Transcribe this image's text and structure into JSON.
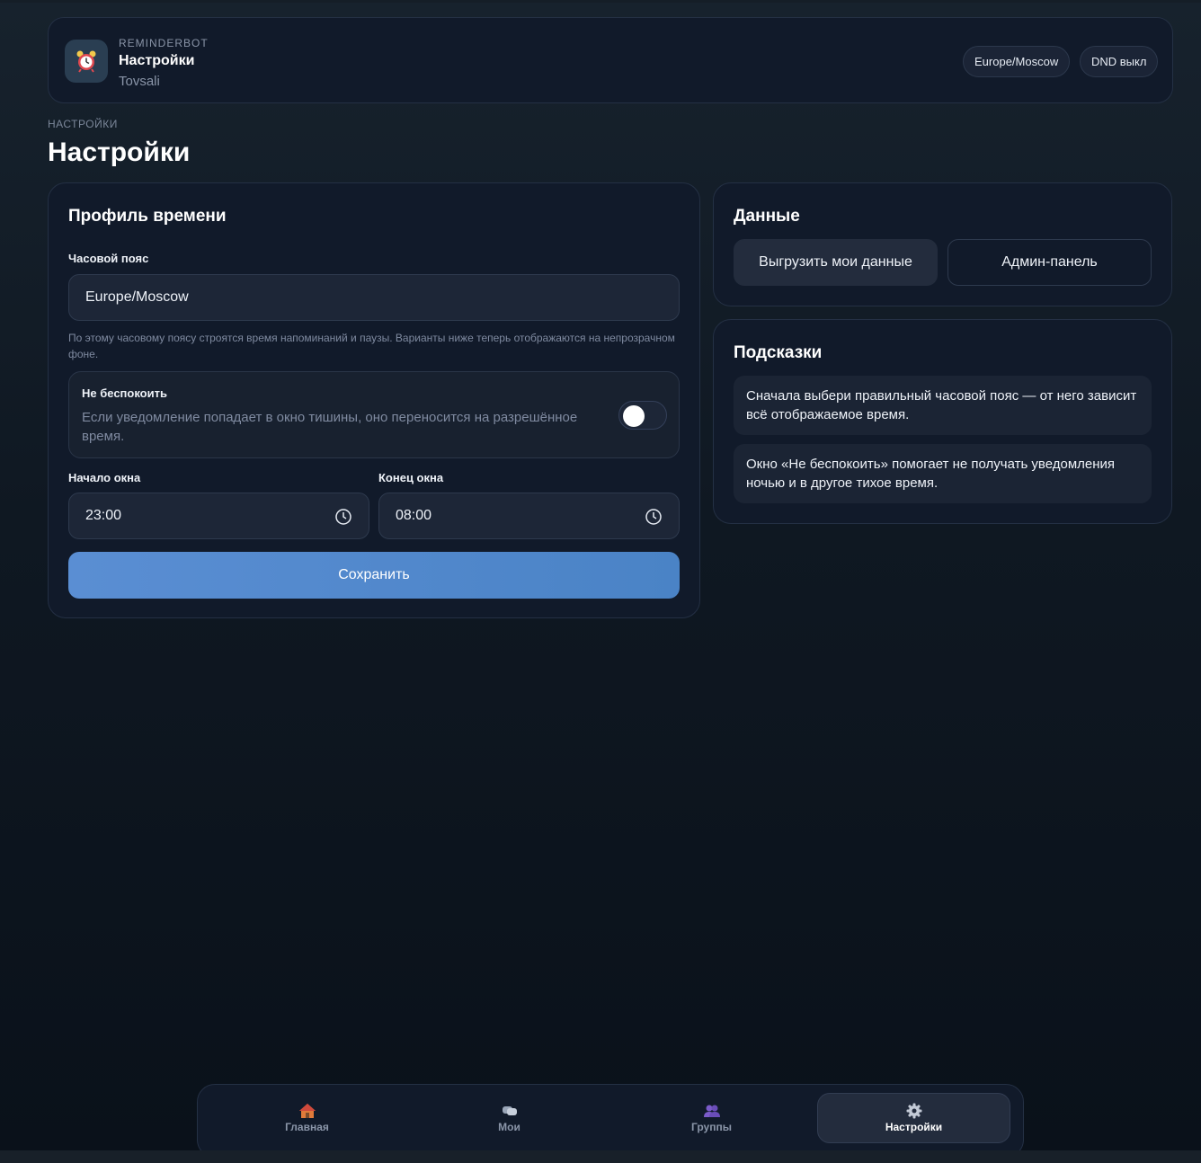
{
  "header": {
    "brand": "REMINDERBOT",
    "title": "Настройки",
    "user": "Tovsali",
    "timezone_pill": "Europe/Moscow",
    "dnd_pill": "DND выкл"
  },
  "page": {
    "section_label": "НАСТРОЙКИ",
    "title": "Настройки"
  },
  "profile": {
    "title": "Профиль времени",
    "timezone_label": "Часовой пояс",
    "timezone_value": "Europe/Moscow",
    "timezone_hint": "По этому часовому поясу строятся время напоминаний и паузы. Варианты ниже теперь отображаются на непрозрачном фоне.",
    "dnd": {
      "title": "Не беспокоить",
      "description": "Если уведомление попадает в окно тишины, оно переносится на разрешённое время.",
      "enabled": false
    },
    "window_start_label": "Начало окна",
    "window_start_value": "23:00",
    "window_end_label": "Конец окна",
    "window_end_value": "08:00",
    "save_label": "Сохранить"
  },
  "data_card": {
    "title": "Данные",
    "export_label": "Выгрузить мои данные",
    "admin_label": "Админ-панель"
  },
  "tips_card": {
    "title": "Подсказки",
    "tips": [
      "Сначала выбери правильный часовой пояс — от него зависит всё отображаемое время.",
      "Окно «Не беспокоить» помогает не получать уведомления ночью и в другое тихое время."
    ]
  },
  "nav": {
    "items": [
      {
        "label": "Главная",
        "icon": "house-icon"
      },
      {
        "label": "Мои",
        "icon": "chat-icon"
      },
      {
        "label": "Группы",
        "icon": "users-icon"
      },
      {
        "label": "Настройки",
        "icon": "gear-icon",
        "active": true
      }
    ]
  },
  "colors": {
    "accent": "#4a83c6",
    "background": "#0f1822",
    "card": "#111a2a"
  }
}
